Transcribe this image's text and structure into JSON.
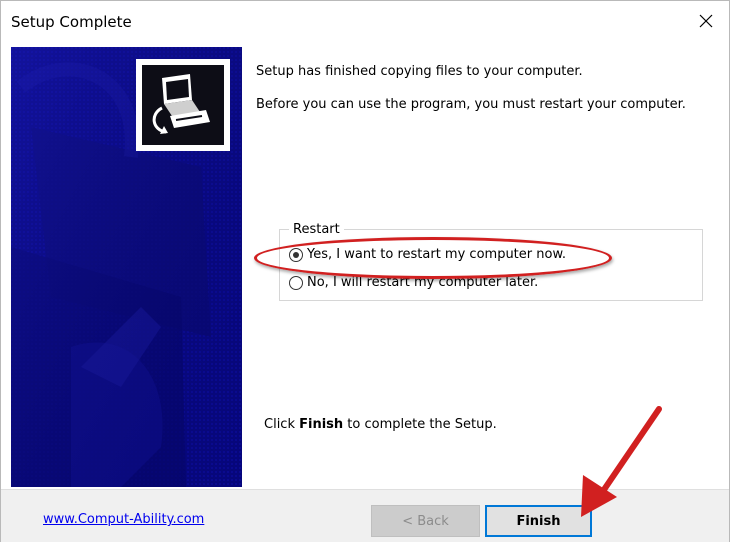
{
  "window": {
    "title": "Setup Complete",
    "close_glyph": "✕"
  },
  "content": {
    "line1": "Setup has finished copying files to your computer.",
    "line2": "Before you can use the program, you must restart your computer.",
    "group_label": "Restart",
    "options": [
      {
        "label": "Yes, I want to restart my computer now.",
        "selected": true
      },
      {
        "label": "No, I will restart my computer later.",
        "selected": false
      }
    ],
    "finish_hint_prefix": "Click ",
    "finish_hint_bold": "Finish",
    "finish_hint_suffix": " to complete the Setup."
  },
  "footer": {
    "link_text": "www.Comput-Ability.com",
    "back_label": "< Back",
    "finish_label": "Finish"
  },
  "colors": {
    "banner": "#08088a",
    "annotation": "#d12020",
    "focus": "#0078d7"
  }
}
